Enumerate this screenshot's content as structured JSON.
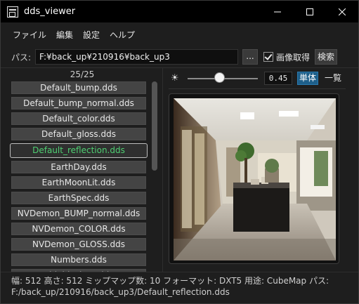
{
  "window": {
    "title": "dds_viewer",
    "minimize_label": "—",
    "maximize_label": "☐",
    "close_label": "✕"
  },
  "menu": [
    "ファイル",
    "編集",
    "設定",
    "ヘルプ"
  ],
  "path": {
    "label": "パス:",
    "value": "F:¥back_up¥210916¥back_up3",
    "browse_label": "...",
    "fetch_label": "画像取得",
    "fetch_checked": true,
    "search_label": "検索"
  },
  "list": {
    "count": "25/25",
    "selected_index": 4,
    "items": [
      "Default_bump.dds",
      "Default_bump_normal.dds",
      "Default_color.dds",
      "Default_gloss.dds",
      "Default_reflection.dds",
      "EarthDay.dds",
      "EarthMoonLit.dds",
      "EarthSpec.dds",
      "NVDemon_BUMP_normal.dds",
      "NVDemon_COLOR.dds",
      "NVDemon_GLOSS.dds",
      "Numbers.dds",
      "Shield_gloss.dds"
    ],
    "scroll_fraction": 0.47
  },
  "viewer": {
    "brightness_icon": "sun-icon",
    "brightness_value": "0.45",
    "brightness_fraction": 0.45,
    "mode_single": "単体",
    "mode_list": "一覧"
  },
  "status": {
    "line1": "幅: 512  高さ: 512  ミップマップ数: 10  フォーマット: DXT5  用途: CubeMap  パス:",
    "line2": "F:/back_up/210916/back_up3/Default_reflection.dds"
  },
  "colors": {
    "selected_text": "#4ecf72",
    "accent": "#1e5f8a"
  }
}
